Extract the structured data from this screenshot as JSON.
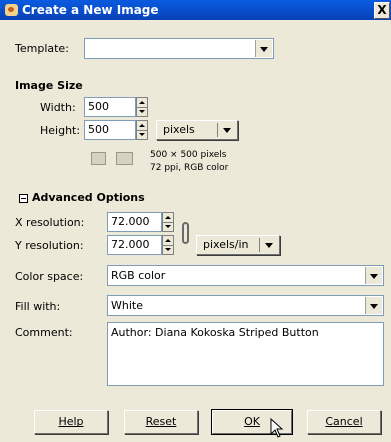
{
  "window": {
    "title": "Create a New Image",
    "close_glyph": "X"
  },
  "template": {
    "label": "Template:",
    "value": ""
  },
  "image_size": {
    "heading": "Image Size",
    "width_label": "Width:",
    "width_value": "500",
    "height_label": "Height:",
    "height_value": "500",
    "unit": "pixels",
    "info_line1": "500 × 500 pixels",
    "info_line2": "72 ppi, RGB color"
  },
  "advanced": {
    "heading": "Advanced Options",
    "x_res_label": "X resolution:",
    "x_res_value": "72.000",
    "y_res_label": "Y resolution:",
    "y_res_value": "72.000",
    "res_unit": "pixels/in",
    "color_space_label": "Color space:",
    "color_space_value": "RGB color",
    "fill_label": "Fill with:",
    "fill_value": "White",
    "comment_label": "Comment:",
    "comment_value": "Author:  Diana Kokoska Striped Button"
  },
  "buttons": {
    "help": "Help",
    "reset": "Reset",
    "ok": "OK",
    "cancel": "Cancel"
  },
  "icons": {
    "app": "gimp-wilber-icon",
    "portrait": "portrait-orientation-icon",
    "landscape": "landscape-orientation-icon",
    "chain": "chain-link-icon",
    "cursor": "mouse-pointer-icon"
  },
  "colors": {
    "titlebar": "#0a5be0",
    "dialog_bg": "#ece9d8",
    "field_border": "#7f9db9"
  }
}
